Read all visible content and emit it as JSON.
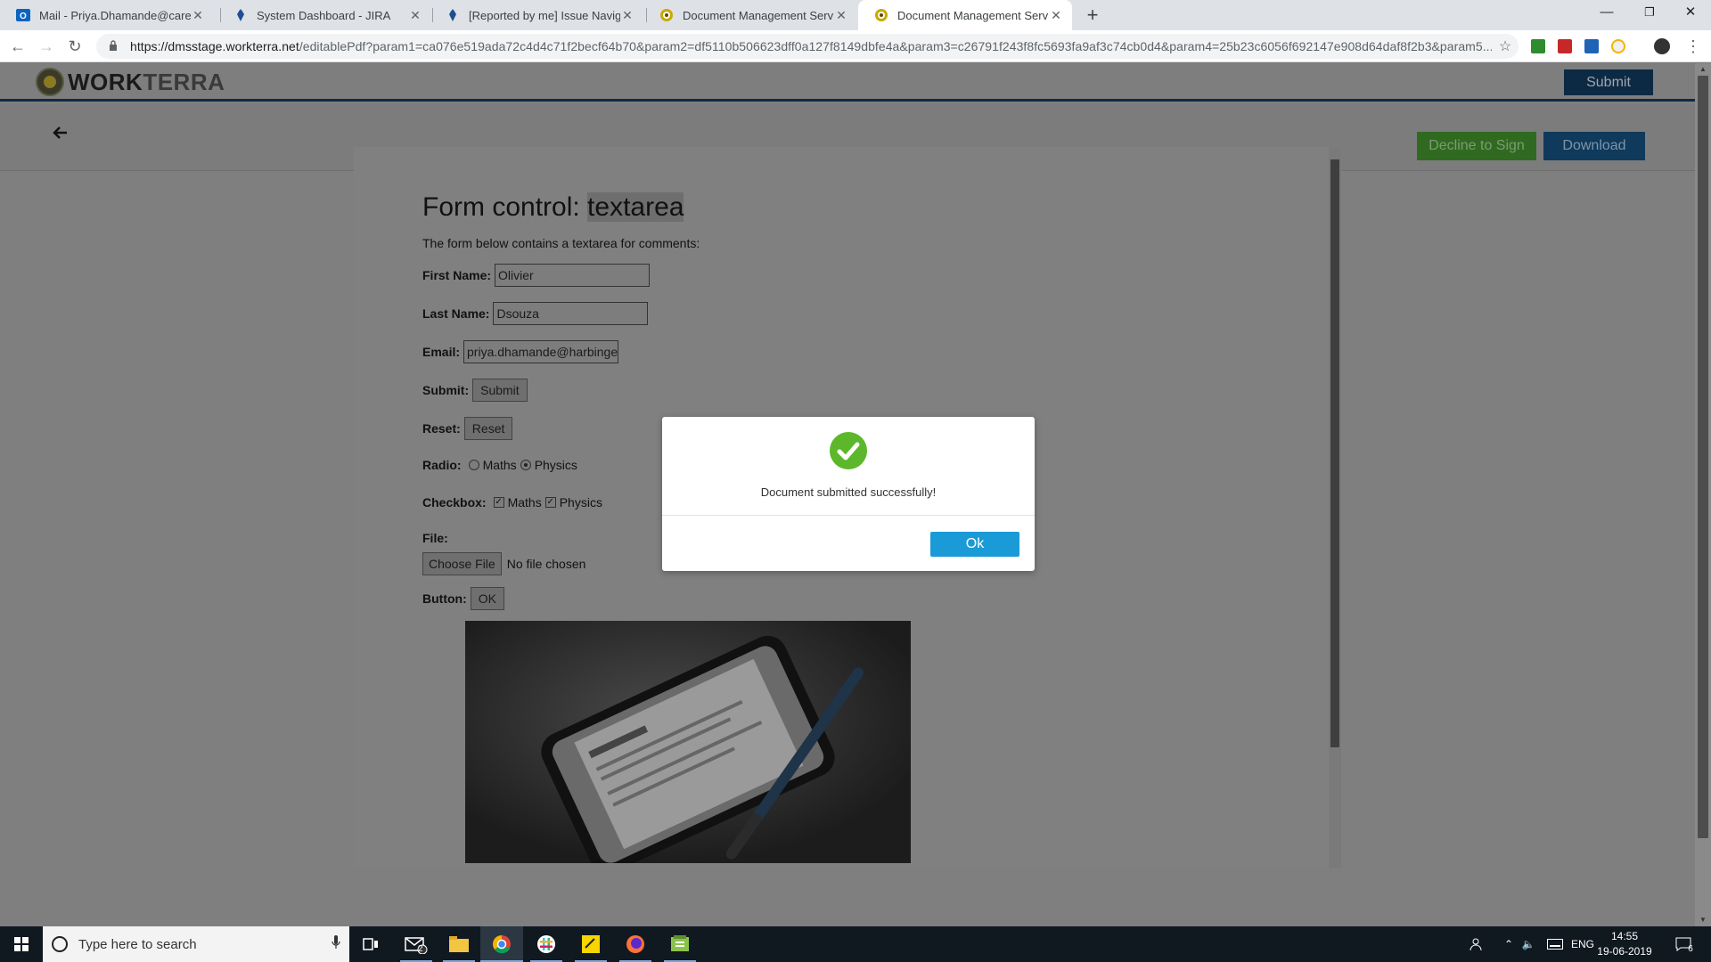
{
  "browser": {
    "tabs": [
      {
        "title": "Mail - Priya.Dhamande@careerbuilder",
        "icon": "outlook-icon"
      },
      {
        "title": "System Dashboard - JIRA",
        "icon": "jira-icon"
      },
      {
        "title": "[Reported by me] Issue Navigator",
        "icon": "jira-icon"
      },
      {
        "title": "Document Management Service",
        "icon": "workterra-icon"
      },
      {
        "title": "Document Management Service",
        "icon": "workterra-icon",
        "active": true
      }
    ],
    "new_tab": "+",
    "url_host": "https://dmsstage.workterra.net",
    "url_path": "/editablePdf?param1=ca076e519ada72c4d4c71f2becf64b70&param2=df5110b506623dff0a127f8149dbfe4a&param3=c26791f243f8fc5693fa9af3c74cb0d4&param4=25b23c6056f692147e908d64daf8f2b3&param5..."
  },
  "app": {
    "logo_work": "WORK",
    "logo_terra": "TERRA",
    "submit_label": "Submit",
    "decline_label": "Decline to Sign",
    "download_label": "Download"
  },
  "form": {
    "title_prefix": "Form control: ",
    "title_highlight": "textarea",
    "intro": "The form below contains a textarea for comments:",
    "first_name_label": "First Name:",
    "first_name_value": "Olivier",
    "last_name_label": "Last Name:",
    "last_name_value": "Dsouza",
    "email_label": "Email:",
    "email_value": "priya.dhamande@harbinge",
    "submit_label": "Submit:",
    "submit_btn": "Submit",
    "reset_label": "Reset:",
    "reset_btn": "Reset",
    "radio_label": "Radio:",
    "radio_opt1": "Maths",
    "radio_opt2": "Physics",
    "checkbox_label": "Checkbox:",
    "check_opt1": "Maths",
    "check_opt2": "Physics",
    "file_label": "File:",
    "choose_file_btn": "Choose File",
    "no_file_text": "No file chosen",
    "button_label": "Button:",
    "ok_btn": "OK"
  },
  "modal": {
    "message": "Document submitted successfully!",
    "ok_label": "Ok"
  },
  "taskbar": {
    "search_placeholder": "Type here to search",
    "mail_badge": "2",
    "language": "ENG",
    "time": "14:55",
    "date": "19-06-2019",
    "notification_count": "6"
  },
  "colors": {
    "modal_accent": "#1a9ad6",
    "success": "#5cb82a",
    "decline_green": "#2f6a20",
    "brand_navy": "#0d2a45"
  }
}
